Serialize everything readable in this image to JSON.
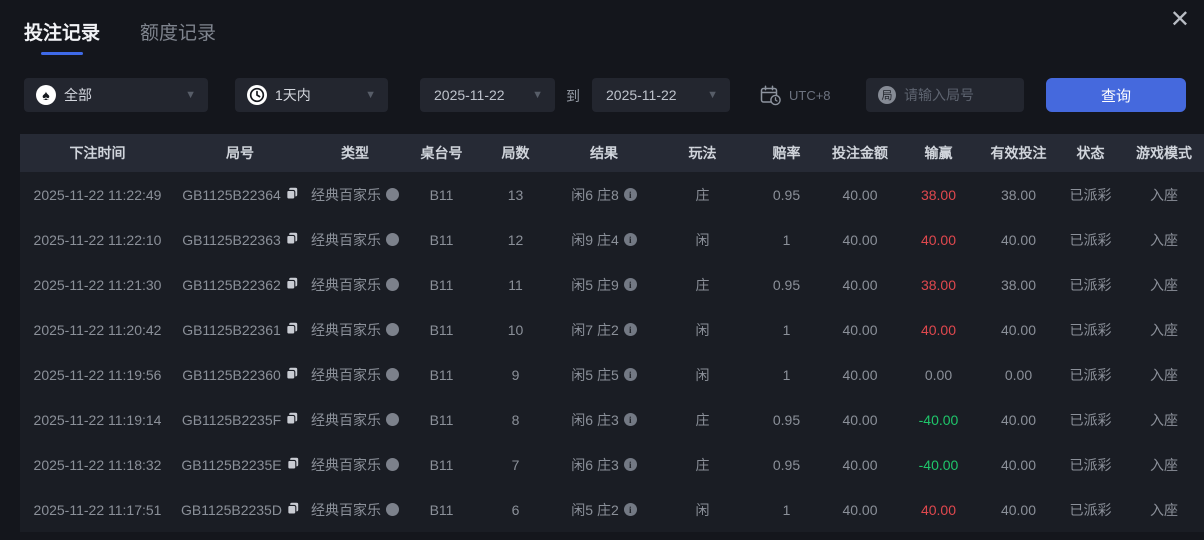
{
  "tabs": [
    {
      "label": "投注记录",
      "active": true
    },
    {
      "label": "额度记录",
      "active": false
    }
  ],
  "close_icon": "✕",
  "filters": {
    "game_type": {
      "value": "全部",
      "icon": "spade-icon"
    },
    "time_range": {
      "value": "1天内",
      "icon": "clock-icon"
    },
    "date_from": "2025-11-22",
    "to_label": "到",
    "date_to": "2025-11-22",
    "timezone": "UTC+8",
    "timezone_icon": "calendar-clock-icon",
    "search": {
      "placeholder": "请输入局号",
      "icon_char": "局"
    },
    "query_button": "查询"
  },
  "table": {
    "headers": [
      "下注时间",
      "局号",
      "类型",
      "桌台号",
      "局数",
      "结果",
      "玩法",
      "赔率",
      "投注金额",
      "输赢",
      "有效投注",
      "状态",
      "游戏模式"
    ],
    "rows": [
      {
        "time": "2025-11-22 11:22:49",
        "game_id": "GB1125B22364",
        "type": "经典百家乐",
        "table_no": "B11",
        "round": "13",
        "result": "闲6 庄8",
        "play": "庄",
        "odds": "0.95",
        "bet_amount": "40.00",
        "win_loss": "38.00",
        "win_loss_color": "red",
        "valid_bet": "38.00",
        "status": "已派彩",
        "mode": "入座"
      },
      {
        "time": "2025-11-22 11:22:10",
        "game_id": "GB1125B22363",
        "type": "经典百家乐",
        "table_no": "B11",
        "round": "12",
        "result": "闲9 庄4",
        "play": "闲",
        "odds": "1",
        "bet_amount": "40.00",
        "win_loss": "40.00",
        "win_loss_color": "red",
        "valid_bet": "40.00",
        "status": "已派彩",
        "mode": "入座"
      },
      {
        "time": "2025-11-22 11:21:30",
        "game_id": "GB1125B22362",
        "type": "经典百家乐",
        "table_no": "B11",
        "round": "11",
        "result": "闲5 庄9",
        "play": "庄",
        "odds": "0.95",
        "bet_amount": "40.00",
        "win_loss": "38.00",
        "win_loss_color": "red",
        "valid_bet": "38.00",
        "status": "已派彩",
        "mode": "入座"
      },
      {
        "time": "2025-11-22 11:20:42",
        "game_id": "GB1125B22361",
        "type": "经典百家乐",
        "table_no": "B11",
        "round": "10",
        "result": "闲7 庄2",
        "play": "闲",
        "odds": "1",
        "bet_amount": "40.00",
        "win_loss": "40.00",
        "win_loss_color": "red",
        "valid_bet": "40.00",
        "status": "已派彩",
        "mode": "入座"
      },
      {
        "time": "2025-11-22 11:19:56",
        "game_id": "GB1125B22360",
        "type": "经典百家乐",
        "table_no": "B11",
        "round": "9",
        "result": "闲5 庄5",
        "play": "闲",
        "odds": "1",
        "bet_amount": "40.00",
        "win_loss": "0.00",
        "win_loss_color": "neutral",
        "valid_bet": "0.00",
        "status": "已派彩",
        "mode": "入座"
      },
      {
        "time": "2025-11-22 11:19:14",
        "game_id": "GB1125B2235F",
        "type": "经典百家乐",
        "table_no": "B11",
        "round": "8",
        "result": "闲6 庄3",
        "play": "庄",
        "odds": "0.95",
        "bet_amount": "40.00",
        "win_loss": "-40.00",
        "win_loss_color": "green",
        "valid_bet": "40.00",
        "status": "已派彩",
        "mode": "入座"
      },
      {
        "time": "2025-11-22 11:18:32",
        "game_id": "GB1125B2235E",
        "type": "经典百家乐",
        "table_no": "B11",
        "round": "7",
        "result": "闲6 庄3",
        "play": "庄",
        "odds": "0.95",
        "bet_amount": "40.00",
        "win_loss": "-40.00",
        "win_loss_color": "green",
        "valid_bet": "40.00",
        "status": "已派彩",
        "mode": "入座"
      },
      {
        "time": "2025-11-22 11:17:51",
        "game_id": "GB1125B2235D",
        "type": "经典百家乐",
        "table_no": "B11",
        "round": "6",
        "result": "闲5 庄2",
        "play": "闲",
        "odds": "1",
        "bet_amount": "40.00",
        "win_loss": "40.00",
        "win_loss_color": "red",
        "valid_bet": "40.00",
        "status": "已派彩",
        "mode": "入座"
      }
    ]
  },
  "colors": {
    "accent_blue": "#4569dd",
    "tab_underline_blue": "#3f6ae8",
    "win_red": "#e0484e",
    "loss_green": "#1fc56a",
    "page_bg": "#14161c",
    "table_bg": "#1a1d24",
    "header_bg": "#262a35"
  }
}
